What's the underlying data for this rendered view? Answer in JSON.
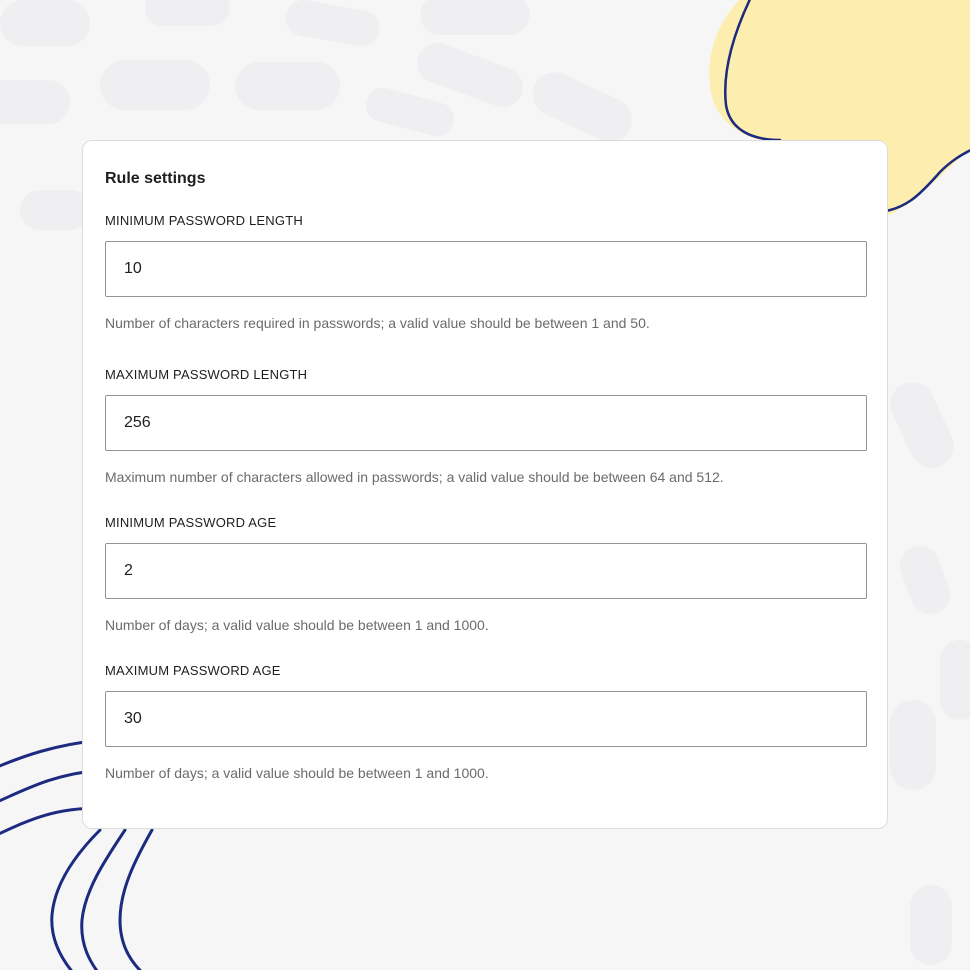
{
  "colors": {
    "background": "#f6f6f7",
    "blob": "#fdeeb0",
    "line": "#1c2a7f",
    "card": "#ffffff",
    "input_border": "#949494",
    "help_text": "#6b6b6b"
  },
  "card": {
    "title": "Rule settings"
  },
  "fields": [
    {
      "label": "MINIMUM PASSWORD LENGTH",
      "value": "10",
      "help": "Number of characters required in passwords; a valid value should be between 1 and 50."
    },
    {
      "label": "MAXIMUM PASSWORD LENGTH",
      "value": "256",
      "help": "Maximum number of characters allowed in passwords; a valid value should be between 64 and 512."
    },
    {
      "label": "MINIMUM PASSWORD AGE",
      "value": "2",
      "help": "Number of days; a valid value should be between 1 and 1000."
    },
    {
      "label": "MAXIMUM PASSWORD AGE",
      "value": "30",
      "help": "Number of days; a valid value should be between 1 and 1000."
    }
  ]
}
